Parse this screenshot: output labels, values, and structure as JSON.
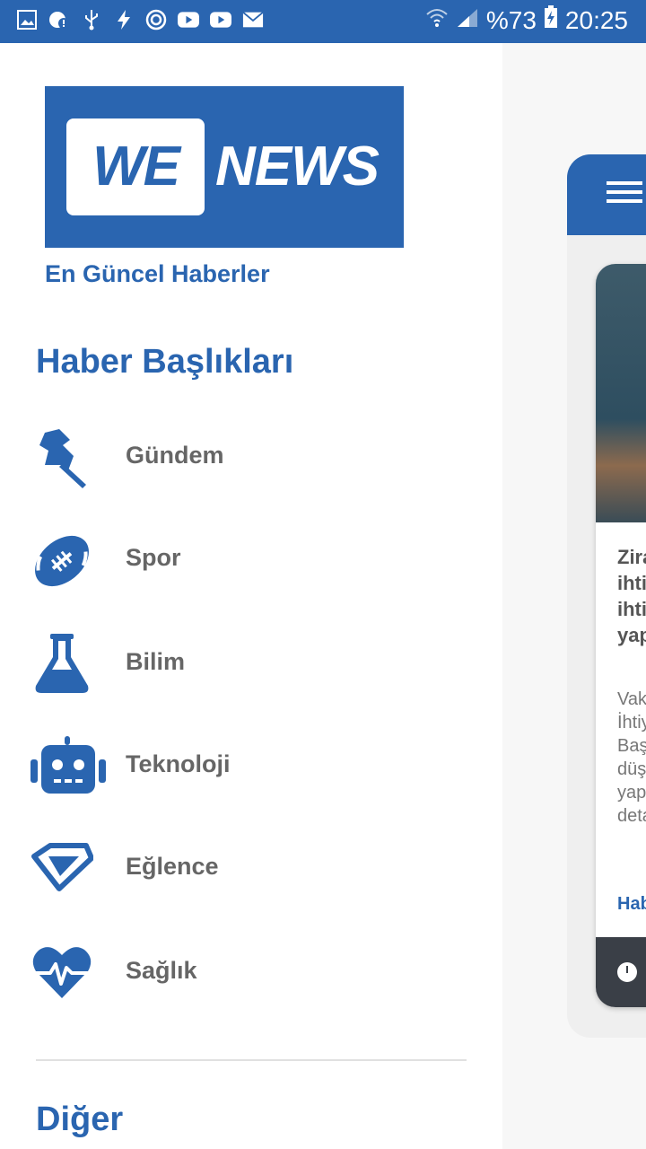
{
  "status_bar": {
    "left_icons": [
      "gallery-icon",
      "alert-icon",
      "usb-icon",
      "flash-icon",
      "sync-icon",
      "youtube-icon",
      "youtube-icon-2",
      "mail-icon"
    ],
    "battery": "%73",
    "time": "20:25",
    "bg_color": "#2a65b0"
  },
  "drawer": {
    "logo": {
      "we": "WE",
      "news": "NEWS"
    },
    "tagline": "En Güncel Haberler",
    "section_title": "Haber Başlıkları",
    "items": [
      {
        "label": "Gündem",
        "icon": "pin-icon"
      },
      {
        "label": "Spor",
        "icon": "football-icon"
      },
      {
        "label": "Bilim",
        "icon": "flask-icon"
      },
      {
        "label": "Teknoloji",
        "icon": "robot-icon"
      },
      {
        "label": "Eğlence",
        "icon": "diamond-icon"
      },
      {
        "label": "Sağlık",
        "icon": "heartbeat-icon"
      }
    ],
    "other_title": "Diğer"
  },
  "background_app": {
    "card_title": "Zira\nihti\nihti\nyap",
    "card_desc": "Vak\nİhtiy\nBaş\ndüş\nyap\ndeta",
    "source": "Hab"
  },
  "colors": {
    "accent": "#2a65b0",
    "text_gray": "#666666",
    "footer_dark": "#3a3f47"
  }
}
